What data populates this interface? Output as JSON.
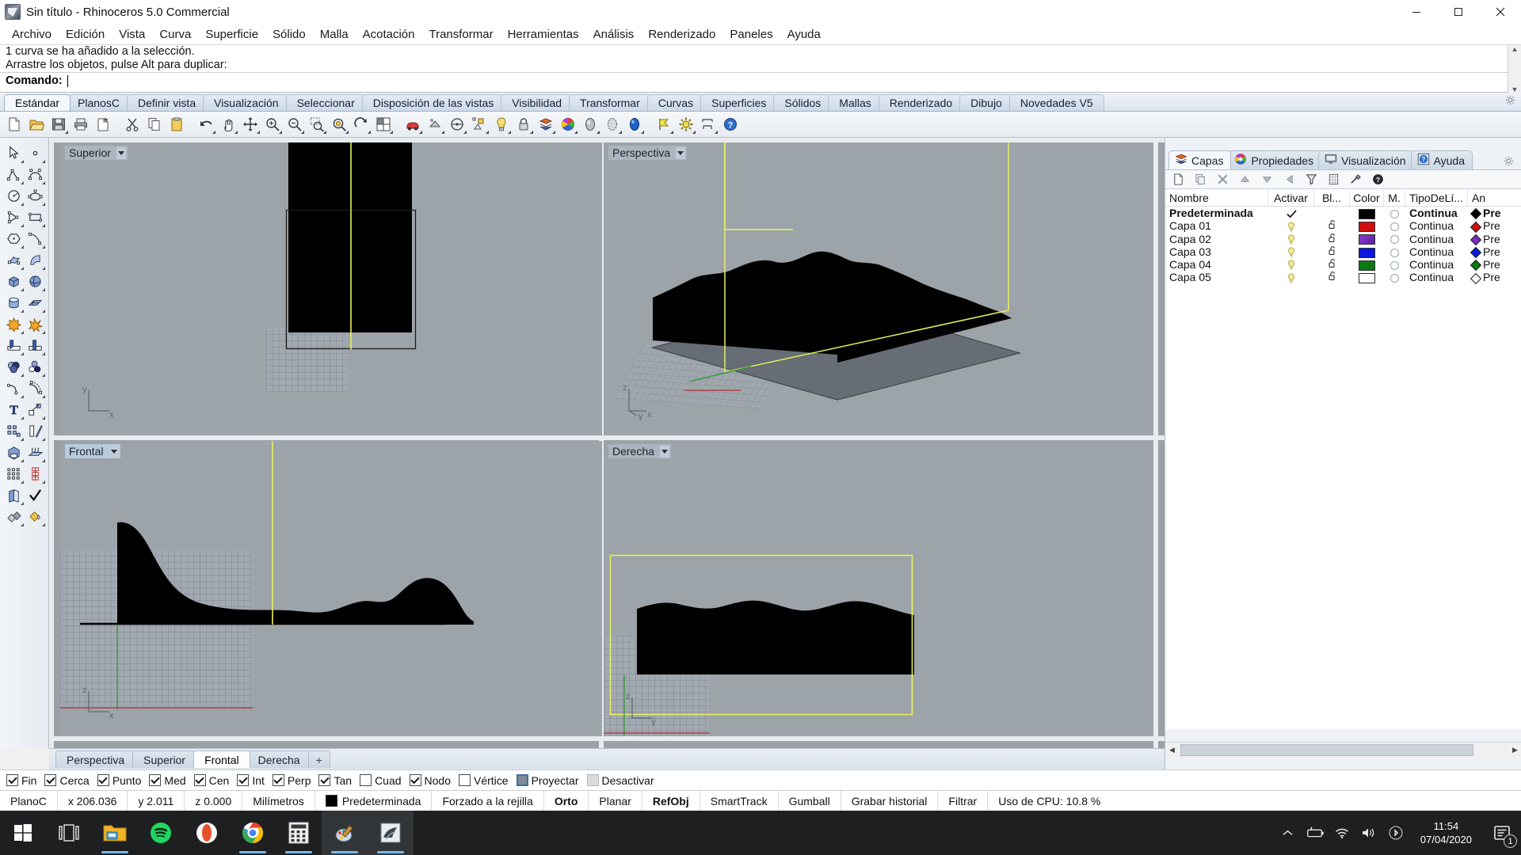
{
  "window": {
    "title": "Sin título - Rhinoceros 5.0 Commercial",
    "minimize_label": "Minimizar",
    "maximize_label": "Restaurar",
    "close_label": "Cerrar"
  },
  "menubar": {
    "items": [
      "Archivo",
      "Edición",
      "Vista",
      "Curva",
      "Superficie",
      "Sólido",
      "Malla",
      "Acotación",
      "Transformar",
      "Herramientas",
      "Análisis",
      "Renderizado",
      "Paneles",
      "Ayuda"
    ]
  },
  "command_area": {
    "history": [
      "1 curva se ha añadido a la selección.",
      "Arrastre los objetos, pulse Alt para duplicar:"
    ],
    "prompt_label": "Comando:",
    "prompt_value": ""
  },
  "toolbar_tabs": {
    "active": "Estándar",
    "items": [
      "Estándar",
      "PlanosC",
      "Definir vista",
      "Visualización",
      "Seleccionar",
      "Disposición de las vistas",
      "Visibilidad",
      "Transformar",
      "Curvas",
      "Superficies",
      "Sólidos",
      "Mallas",
      "Renderizado",
      "Dibujo",
      "Novedades V5"
    ]
  },
  "main_toolbar": {
    "buttons": [
      "new-file-icon",
      "open-folder-icon",
      "save-icon",
      "print-icon",
      "save-as-icon",
      "cut-icon",
      "copy-icon",
      "paste-icon",
      "undo-icon",
      "pan-hand-icon",
      "zoom-extents-icon",
      "zoom-in-icon",
      "zoom-out-icon",
      "zoom-window-icon",
      "zoom-selected-icon",
      "rotate-view-icon",
      "four-view-icon",
      "render-icon",
      "shade-icon",
      "analyze-icon",
      "cplane-icon",
      "light-icon",
      "lock-icon",
      "layers-icon",
      "color-wheel-icon",
      "sphere-shade-icon",
      "sphere-ghost-icon",
      "sphere-render-icon",
      "flag-icon",
      "options-gear-icon",
      "dimension-icon",
      "help-icon"
    ]
  },
  "left_toolbar": {
    "buttons": [
      "select-arrow-icon",
      "point-icon",
      "polyline-icon",
      "curve-icon",
      "circle-icon",
      "ellipse-icon",
      "arc-icon",
      "rectangle-icon",
      "polygon-icon",
      "curve-interp-icon",
      "surface-corner-icon",
      "surface-loft-icon",
      "box-icon",
      "sphere-solid-icon",
      "cylinder-icon",
      "surface-plane-icon",
      "boolean-union-icon",
      "explode-icon",
      "trim-icon",
      "split-icon",
      "boolean-sphere-icon",
      "boolean-two-icon",
      "fillet-curve-icon",
      "offset-curve-icon",
      "text-icon",
      "scale-icon",
      "array-icon",
      "mirror-icon",
      "cap-icon",
      "extrude-icon",
      "grid-array-icon",
      "rectangular-array-icon",
      "shell-icon",
      "check-icon",
      "intersect-icon",
      "paint-bucket-icon"
    ]
  },
  "viewports": [
    {
      "name": "Superior",
      "active": false,
      "axis": [
        "y",
        "x"
      ]
    },
    {
      "name": "Perspectiva",
      "active": false,
      "axis": [
        "z",
        "y",
        "x"
      ]
    },
    {
      "name": "Frontal",
      "active": true,
      "axis": [
        "z",
        "x"
      ]
    },
    {
      "name": "Derecha",
      "active": false,
      "axis": [
        "z",
        "y"
      ]
    }
  ],
  "viewport_tabs": {
    "active": "Frontal",
    "items": [
      "Perspectiva",
      "Superior",
      "Frontal",
      "Derecha"
    ],
    "add_label": "+"
  },
  "right_panel": {
    "tabs": [
      {
        "label": "Capas",
        "icon": "layers-icon",
        "active": true
      },
      {
        "label": "Propiedades",
        "icon": "color-wheel-icon",
        "active": false
      },
      {
        "label": "Visualización",
        "icon": "monitor-icon",
        "active": false
      },
      {
        "label": "Ayuda",
        "icon": "help-icon",
        "active": false
      }
    ],
    "toolbar_buttons": [
      "new-layer-icon",
      "copy-layer-icon",
      "delete-layer-icon",
      "move-up-icon",
      "move-down-icon",
      "move-left-icon",
      "filter-icon",
      "layer-sheet-icon",
      "tools-hammer-icon",
      "help-question-icon"
    ],
    "columns": [
      "Nombre",
      "Activar",
      "Bl...",
      "Color",
      "M.",
      "TipoDeLí...",
      "An"
    ],
    "rows": [
      {
        "name": "Predeterminada",
        "current": true,
        "on": false,
        "lock": false,
        "color": "#000000",
        "linetype": "Continua",
        "width": "Pre",
        "bold": true
      },
      {
        "name": "Capa 01",
        "current": false,
        "on": true,
        "lock": true,
        "color": "#d01010",
        "linetype": "Continua",
        "width": "Pre",
        "bold": false
      },
      {
        "name": "Capa 02",
        "current": false,
        "on": true,
        "lock": true,
        "color": "#7b2ec4",
        "linetype": "Continua",
        "width": "Pre",
        "bold": false
      },
      {
        "name": "Capa 03",
        "current": false,
        "on": true,
        "lock": true,
        "color": "#0b18e0",
        "linetype": "Continua",
        "width": "Pre",
        "bold": false
      },
      {
        "name": "Capa 04",
        "current": false,
        "on": true,
        "lock": true,
        "color": "#0a7a12",
        "linetype": "Continua",
        "width": "Pre",
        "bold": false
      },
      {
        "name": "Capa 05",
        "current": false,
        "on": true,
        "lock": true,
        "color": "#ffffff",
        "linetype": "Continua",
        "width": "Pre",
        "bold": false
      }
    ]
  },
  "osnap": {
    "items": [
      {
        "label": "Fin",
        "state": "checked"
      },
      {
        "label": "Cerca",
        "state": "checked"
      },
      {
        "label": "Punto",
        "state": "checked"
      },
      {
        "label": "Med",
        "state": "checked"
      },
      {
        "label": "Cen",
        "state": "checked"
      },
      {
        "label": "Int",
        "state": "checked"
      },
      {
        "label": "Perp",
        "state": "checked"
      },
      {
        "label": "Tan",
        "state": "checked"
      },
      {
        "label": "Cuad",
        "state": "unchecked"
      },
      {
        "label": "Nodo",
        "state": "checked"
      },
      {
        "label": "Vértice",
        "state": "unchecked"
      },
      {
        "label": "Proyectar",
        "state": "filled"
      },
      {
        "label": "Desactivar",
        "state": "disabled"
      }
    ]
  },
  "statusbar": {
    "cplane": "PlanoC",
    "x": "x 206.036",
    "y": "y 2.011",
    "z": "z 0.000",
    "units": "Milímetros",
    "layer": "Predeterminada",
    "layer_color": "#000000",
    "snap": "Forzado a la rejilla",
    "ortho": "Orto",
    "planar": "Planar",
    "osnap": "RefObj",
    "smarttrack": "SmartTrack",
    "gumball": "Gumball",
    "history": "Grabar historial",
    "filter": "Filtrar",
    "cpu": "Uso de CPU: 10.8 %"
  },
  "taskbar": {
    "start_label": "Inicio",
    "items": [
      {
        "name": "task-view-icon",
        "active": false,
        "running": false
      },
      {
        "name": "file-explorer-icon",
        "active": false,
        "running": true
      },
      {
        "name": "spotify-icon",
        "active": false,
        "running": false
      },
      {
        "name": "opera-icon",
        "active": false,
        "running": false
      },
      {
        "name": "chrome-icon",
        "active": false,
        "running": true
      },
      {
        "name": "calculator-icon",
        "active": false,
        "running": true
      },
      {
        "name": "paint-icon",
        "active": true,
        "running": true
      },
      {
        "name": "rhino-icon",
        "active": true,
        "running": true
      }
    ],
    "tray": [
      "show-hidden-icons-icon",
      "battery-icon",
      "wifi-icon",
      "volume-icon",
      "bluetooth-icon"
    ],
    "time": "11:54",
    "date": "07/04/2020",
    "notification_count": "1"
  },
  "colors": {
    "viewport_bg": "#9ca3a9",
    "accent": "#3c6ea5",
    "selection_yellow": "#e8ef5c",
    "geometry_black": "#000000"
  }
}
